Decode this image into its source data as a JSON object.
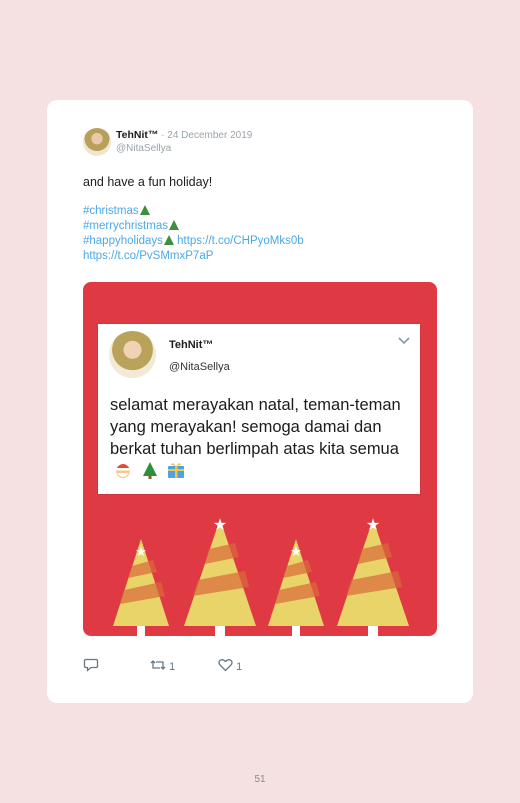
{
  "tweet": {
    "name": "TehNit™",
    "separator": " · ",
    "date": "24 December 2019",
    "handle": "@NitaSellya",
    "text": "and have a fun holiday!",
    "hashtags": [
      "#christmas",
      "#merrychristmas",
      "#happyholidays"
    ],
    "link1": "https://t.co/CHPyoMks0b",
    "link2": "https://t.co/PvSMmxP7aP"
  },
  "embedded": {
    "name": "TehNit™",
    "handle": "@NitaSellya",
    "text": "selamat merayakan natal, teman-teman yang merayakan! semoga damai dan berkat tuhan berlimpah atas kita semua"
  },
  "actions": {
    "reply_count": "",
    "retweet_count": "1",
    "like_count": "1"
  },
  "page": {
    "number": "51"
  },
  "colors": {
    "background": "#f5e1e2",
    "card": "#ffffff",
    "media_red": "#df3a43",
    "link": "#4aa8e8",
    "tree_yellow": "#e9d46a"
  }
}
